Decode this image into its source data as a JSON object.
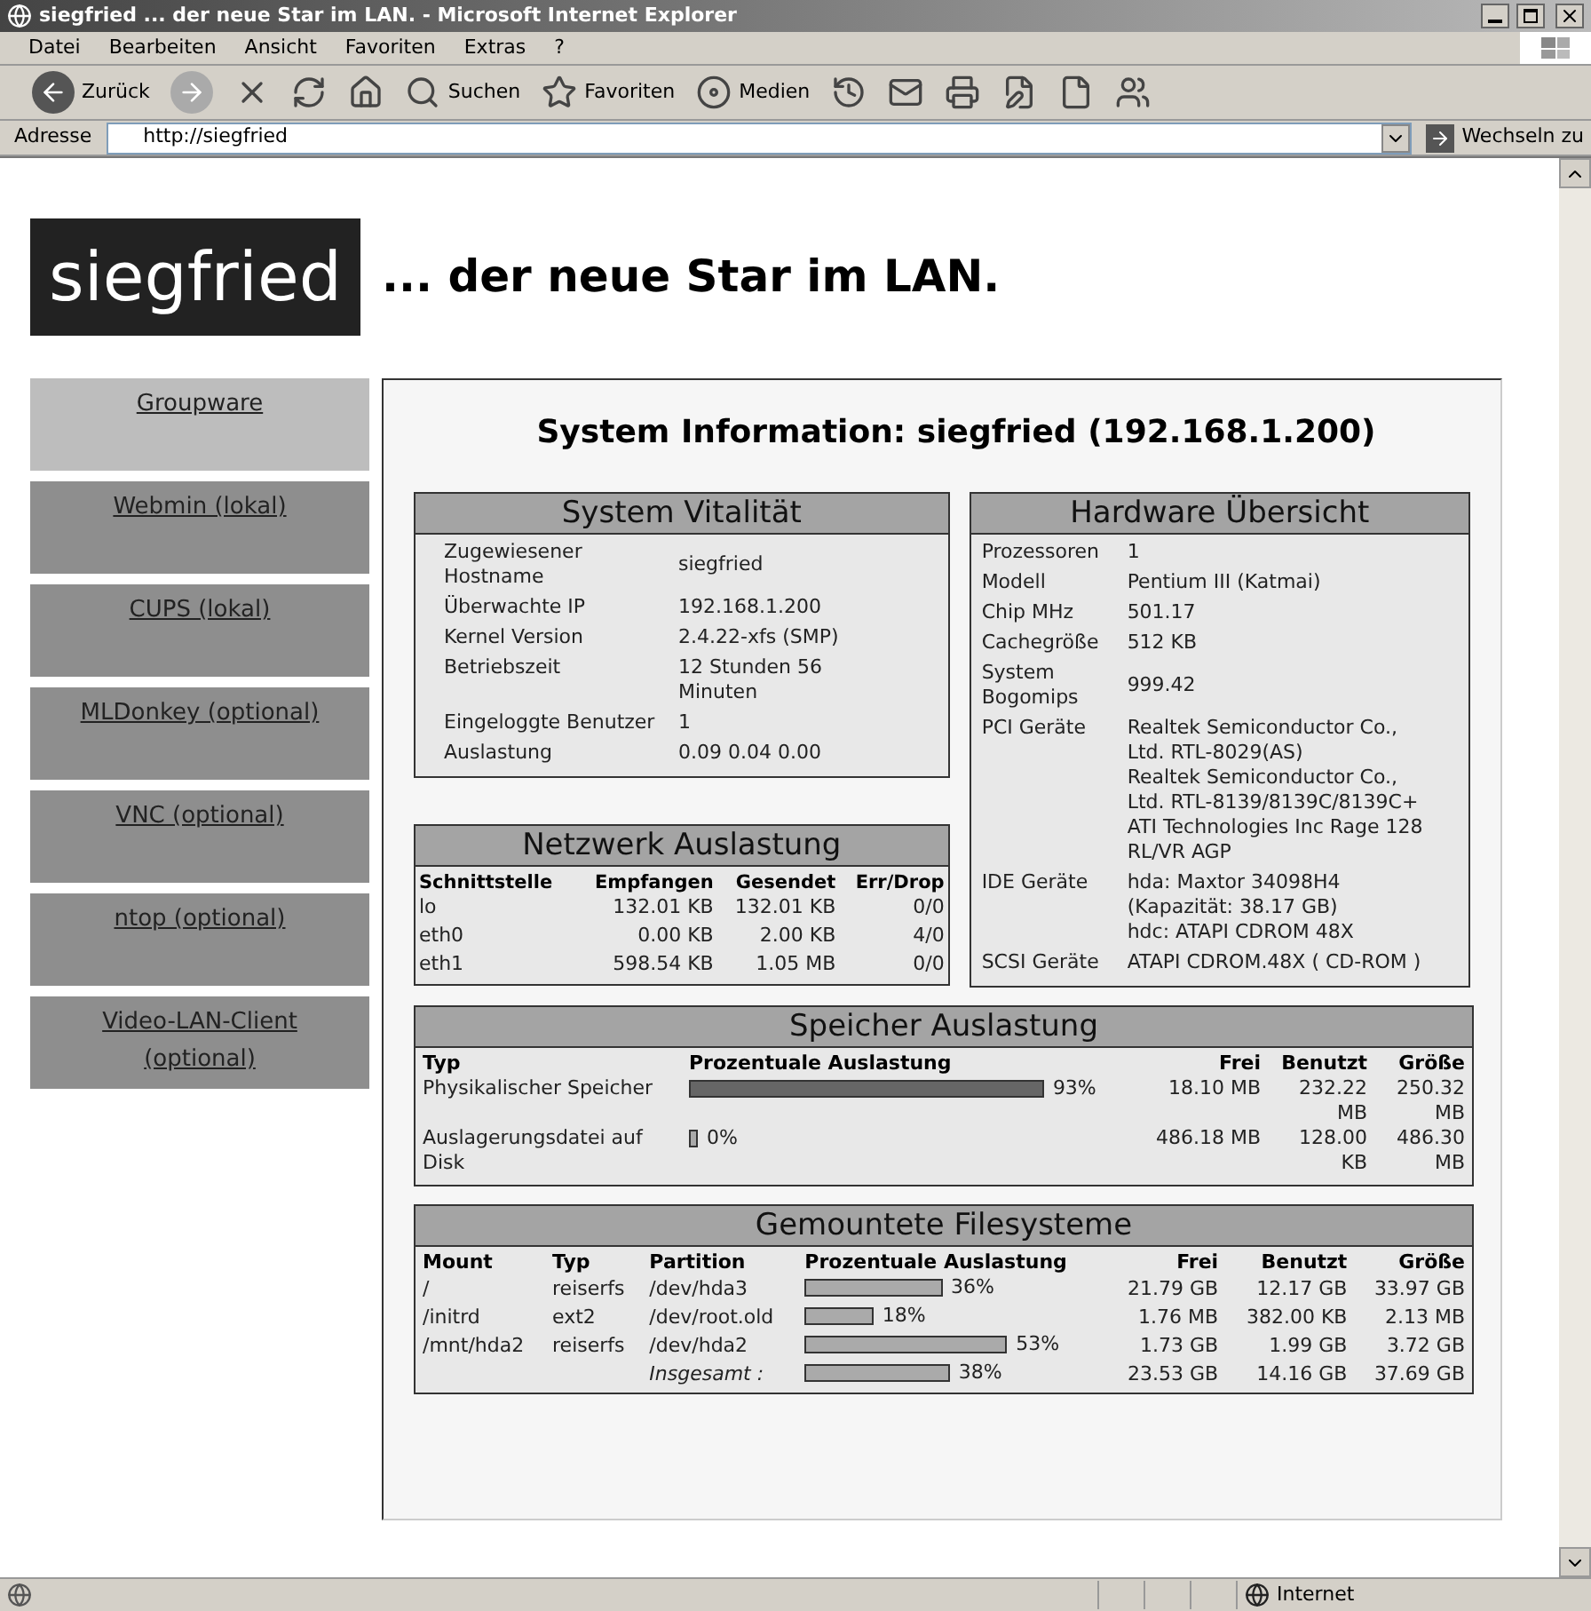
{
  "window": {
    "title": "siegfried ... der neue Star im LAN. - Microsoft Internet Explorer"
  },
  "menu": [
    "Datei",
    "Bearbeiten",
    "Ansicht",
    "Favoriten",
    "Extras",
    "?"
  ],
  "toolbar": [
    {
      "kind": "back",
      "label": "Zurück"
    },
    {
      "kind": "forward"
    },
    {
      "kind": "stop"
    },
    {
      "kind": "refresh"
    },
    {
      "kind": "home"
    },
    {
      "kind": "search",
      "label": "Suchen"
    },
    {
      "kind": "favorites",
      "label": "Favoriten"
    },
    {
      "kind": "media",
      "label": "Medien"
    },
    {
      "kind": "history"
    },
    {
      "kind": "mail"
    },
    {
      "kind": "print"
    },
    {
      "kind": "edit"
    },
    {
      "kind": "note"
    },
    {
      "kind": "messenger"
    }
  ],
  "address": {
    "label": "Adresse",
    "value": "http://siegfried",
    "go": "Wechseln zu"
  },
  "page": {
    "logo": "siegfried",
    "tagline": "... der neue Star im LAN.",
    "nav": [
      {
        "label": "Groupware",
        "selected": true
      },
      {
        "label": "Webmin (lokal)",
        "selected": false
      },
      {
        "label": "CUPS (lokal)",
        "selected": false
      },
      {
        "label": "MLDonkey (optional)",
        "selected": false
      },
      {
        "label": "VNC (optional)",
        "selected": false
      },
      {
        "label": "ntop (optional)",
        "selected": false
      },
      {
        "label": "Video-LAN-Client (optional)",
        "selected": false
      }
    ],
    "title": "System Information: siegfried (192.168.1.200)",
    "vitality": {
      "title": "System Vitalität",
      "rows": [
        {
          "label": "Zugewiesener Hostname",
          "value": "siegfried"
        },
        {
          "label": "Überwachte IP",
          "value": "192.168.1.200"
        },
        {
          "label": "Kernel Version",
          "value": "2.4.22-xfs (SMP)"
        },
        {
          "label": "Betriebszeit",
          "value": "12 Stunden 56 Minuten"
        },
        {
          "label": "Eingeloggte Benutzer",
          "value": "1"
        },
        {
          "label": "Auslastung",
          "value": "0.09 0.04 0.00"
        }
      ]
    },
    "network": {
      "title": "Netzwerk Auslastung",
      "columns": [
        "Schnittstelle",
        "Empfangen",
        "Gesendet",
        "Err/Drop"
      ],
      "rows": [
        [
          "lo",
          "132.01 KB",
          "132.01 KB",
          "0/0"
        ],
        [
          "eth0",
          "0.00 KB",
          "2.00 KB",
          "4/0"
        ],
        [
          "eth1",
          "598.54 KB",
          "1.05 MB",
          "0/0"
        ]
      ]
    },
    "hardware": {
      "title": "Hardware Übersicht",
      "rows": [
        {
          "label": "Prozessoren",
          "values": [
            "1"
          ]
        },
        {
          "label": "Modell",
          "values": [
            "Pentium III (Katmai)"
          ]
        },
        {
          "label": "Chip MHz",
          "values": [
            "501.17"
          ]
        },
        {
          "label": "Cachegröße",
          "values": [
            "512 KB"
          ]
        },
        {
          "label": "System Bogomips",
          "values": [
            "999.42"
          ]
        },
        {
          "label": "PCI Geräte",
          "values": [
            "Realtek Semiconductor Co., Ltd. RTL-8029(AS)",
            "Realtek Semiconductor Co., Ltd. RTL-8139/8139C/8139C+",
            "ATI Technologies Inc Rage 128 RL/VR AGP"
          ]
        },
        {
          "label": "IDE Geräte",
          "values": [
            "hda: Maxtor 34098H4 (Kapazität: 38.17 GB)",
            "hdc: ATAPI CDROM 48X"
          ]
        },
        {
          "label": "SCSI Geräte",
          "values": [
            "ATAPI CDROM.48X ( CD-ROM )"
          ]
        }
      ]
    },
    "memory": {
      "title": "Speicher Auslastung",
      "columns": [
        "Typ",
        "Prozentuale Auslastung",
        "Frei",
        "Benutzt",
        "Größe"
      ],
      "rows": [
        {
          "type": "Physikalischer Speicher",
          "percent": "93%",
          "free": "18.10 MB",
          "used": "232.22 MB",
          "size": "250.32 MB"
        },
        {
          "type": "Auslagerungsdatei auf Disk",
          "percent": "0%",
          "free": "486.18 MB",
          "used": "128.00 KB",
          "size": "486.30 MB"
        }
      ]
    },
    "filesystems": {
      "title": "Gemountete Filesysteme",
      "columns": [
        "Mount",
        "Typ",
        "Partition",
        "Prozentuale Auslastung",
        "Frei",
        "Benutzt",
        "Größe"
      ],
      "rows": [
        {
          "mount": "/",
          "type": "reiserfs",
          "partition": "/dev/hda3",
          "percent": "36%",
          "free": "21.79 GB",
          "used": "12.17 GB",
          "size": "33.97 GB"
        },
        {
          "mount": "/initrd",
          "type": "ext2",
          "partition": "/dev/root.old",
          "percent": "18%",
          "free": "1.76 MB",
          "used": "382.00 KB",
          "size": "2.13 MB"
        },
        {
          "mount": "/mnt/hda2",
          "type": "reiserfs",
          "partition": "/dev/hda2",
          "percent": "53%",
          "free": "1.73 GB",
          "used": "1.99 GB",
          "size": "3.72 GB"
        }
      ],
      "total": {
        "label": "Insgesamt :",
        "percent": "38%",
        "free": "23.53 GB",
        "used": "14.16 GB",
        "size": "37.69 GB"
      }
    }
  },
  "status_bar": {
    "zone": "Internet"
  }
}
